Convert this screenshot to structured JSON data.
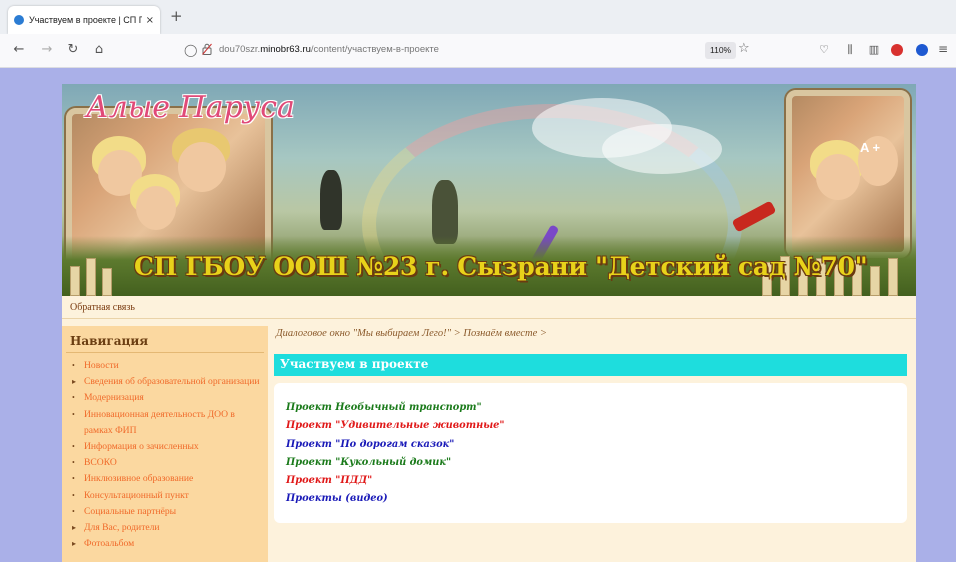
{
  "browser": {
    "tab_title": "Участвуем в проекте | СП ГБО",
    "tab_close": "×",
    "new_tab": "+",
    "url_host": "dou70szr.minobr63.ru",
    "url_prefix": "dou70szr.",
    "url_domain": "minobr63.ru",
    "url_path": "/content/участвуем-в-проекте",
    "zoom": "110%",
    "icons": [
      "back-icon",
      "forward-icon",
      "reload-icon",
      "home-icon",
      "shield-icon",
      "lock-icon",
      "bookmark-star-icon",
      "pocket-icon",
      "library-icon",
      "sidebar-icon",
      "adblock-icon",
      "edge-icon",
      "menu-icon"
    ]
  },
  "header": {
    "logo_text": "Алые Паруса",
    "site_title": "СП ГБОУ ООШ №23 г. Сызрани \"Детский сад №70\"",
    "font_controls": "A +"
  },
  "topnav": {
    "feedback": "Обратная связь"
  },
  "sidebar": {
    "heading": "Навигация",
    "items": [
      {
        "label": "Новости",
        "marker": "•"
      },
      {
        "label": "Сведения об образовательной организации",
        "marker": "▸"
      },
      {
        "label": "Модернизация",
        "marker": "•"
      },
      {
        "label": "Инновационная деятельность ДОО в рамках ФИП",
        "marker": "•"
      },
      {
        "label": "Информация о зачисленных",
        "marker": "•"
      },
      {
        "label": "ВСОКО",
        "marker": "•"
      },
      {
        "label": "Инклюзивное образование",
        "marker": "•"
      },
      {
        "label": "Консультационный пункт",
        "marker": "•"
      },
      {
        "label": "Социальные партнёры",
        "marker": "•"
      },
      {
        "label": "Для Вас, родители",
        "marker": "▸"
      },
      {
        "label": "Фотоальбом",
        "marker": "▸"
      }
    ]
  },
  "main": {
    "breadcrumb": "Диалоговое окно \"Мы выбираем Лего!\" > Познаём вместе >",
    "title": "Участвуем в проекте",
    "projects": [
      {
        "label": "Проект Необычный транспорт\"",
        "color": "#1a7a1a"
      },
      {
        "label": "Проект \"Удивительные животные\"",
        "color": "#e01818"
      },
      {
        "label": "Проект \"По дорогам сказок\"",
        "color": "#1a1ab8"
      },
      {
        "label": "Проект \"Кукольный домик\"",
        "color": "#1a7a1a"
      },
      {
        "label": "Проект \"ПДД\"",
        "color": "#e01818"
      },
      {
        "label": "Проекты (видео)",
        "color": "#1a1ab8"
      }
    ]
  },
  "colors": {
    "page_bg": "#aab0e8",
    "content_bg": "#fdf2dc",
    "sidebar_bg": "#fbd8a0",
    "title_bar": "#1edddd",
    "sidebar_link": "#f06a2a"
  }
}
